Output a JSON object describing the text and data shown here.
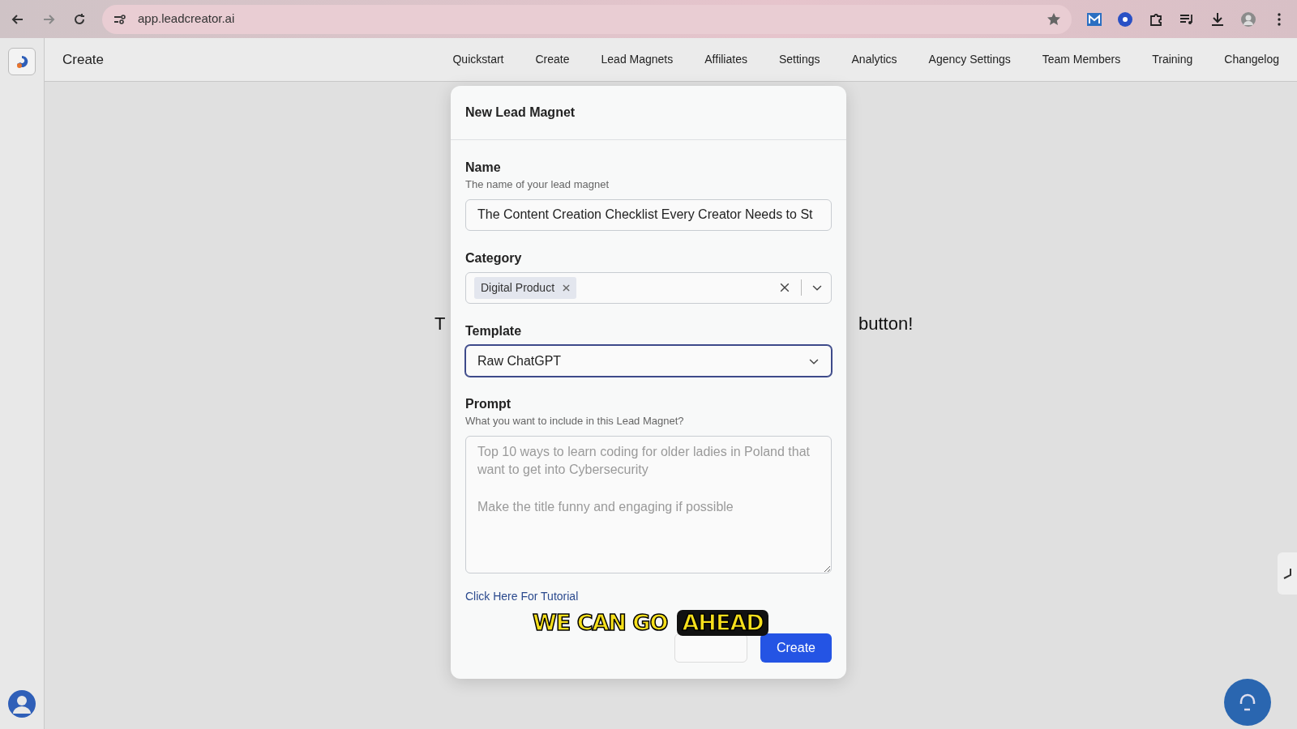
{
  "browser": {
    "url": "app.leadcreator.ai"
  },
  "header": {
    "title": "Create",
    "nav": [
      "Quickstart",
      "Create",
      "Lead Magnets",
      "Affiliates",
      "Settings",
      "Analytics",
      "Agency Settings",
      "Team Members",
      "Training",
      "Changelog"
    ]
  },
  "background_text": {
    "left": "T",
    "right": "button!"
  },
  "modal": {
    "title": "New Lead Magnet",
    "name": {
      "label": "Name",
      "hint": "The name of your lead magnet",
      "value": "The Content Creation Checklist Every Creator Needs to St"
    },
    "category": {
      "label": "Category",
      "tags": [
        "Digital Product"
      ]
    },
    "template": {
      "label": "Template",
      "value": "Raw ChatGPT",
      "focused": true
    },
    "prompt": {
      "label": "Prompt",
      "hint": "What you want to include in this Lead Magnet?",
      "placeholder": "Top 10 ways to learn coding for older ladies in Poland that want to get into Cybersecurity\n\nMake the title funny and engaging if possible"
    },
    "tutorial_link": "Click Here For Tutorial",
    "create_button": "Create"
  },
  "caption": [
    {
      "text": "WE CAN GO",
      "highlighted": false
    },
    {
      "text": "AHEAD",
      "highlighted": true
    }
  ]
}
